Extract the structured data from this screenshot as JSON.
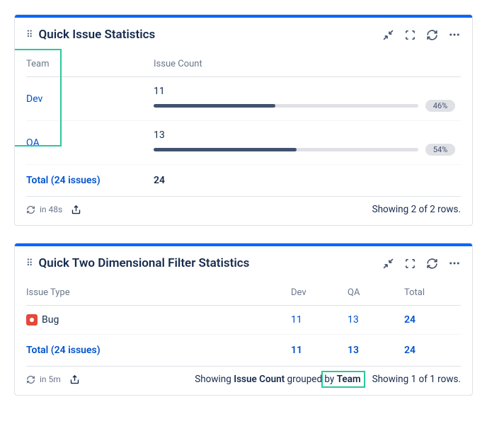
{
  "card1": {
    "title": "Quick Issue Statistics",
    "col_team": "Team",
    "col_count": "Issue Count",
    "rows": [
      {
        "team": "Dev",
        "value": "11",
        "pct": "46%",
        "width": 46
      },
      {
        "team": "QA",
        "value": "13",
        "pct": "54%",
        "width": 54
      }
    ],
    "total_label": "Total (24 issues)",
    "total_value": "24",
    "refresh": "in 48s",
    "footer_rows": "Showing 2 of 2 rows."
  },
  "card2": {
    "title": "Quick Two Dimensional Filter Statistics",
    "col_type": "Issue Type",
    "col_dev": "Dev",
    "col_qa": "QA",
    "col_total": "Total",
    "row_type": "Bug",
    "row_dev": "11",
    "row_qa": "13",
    "row_total": "24",
    "total_label_a": "Total (",
    "total_label_b": "24 issues",
    "total_label_c": ")",
    "total_dev": "11",
    "total_qa": "13",
    "total_total": "24",
    "refresh": "in 5m",
    "footer_mid_a": "Showing ",
    "footer_mid_b": "Issue Count",
    "footer_mid_c": " grouped by ",
    "footer_mid_d": "Team",
    "footer_rows": "Showing 1 of 1 rows."
  },
  "chart_data": {
    "type": "bar",
    "title": "Quick Issue Statistics — Issue Count by Team",
    "categories": [
      "Dev",
      "QA"
    ],
    "values": [
      11,
      13
    ],
    "percentages": [
      46,
      54
    ],
    "total": 24
  }
}
